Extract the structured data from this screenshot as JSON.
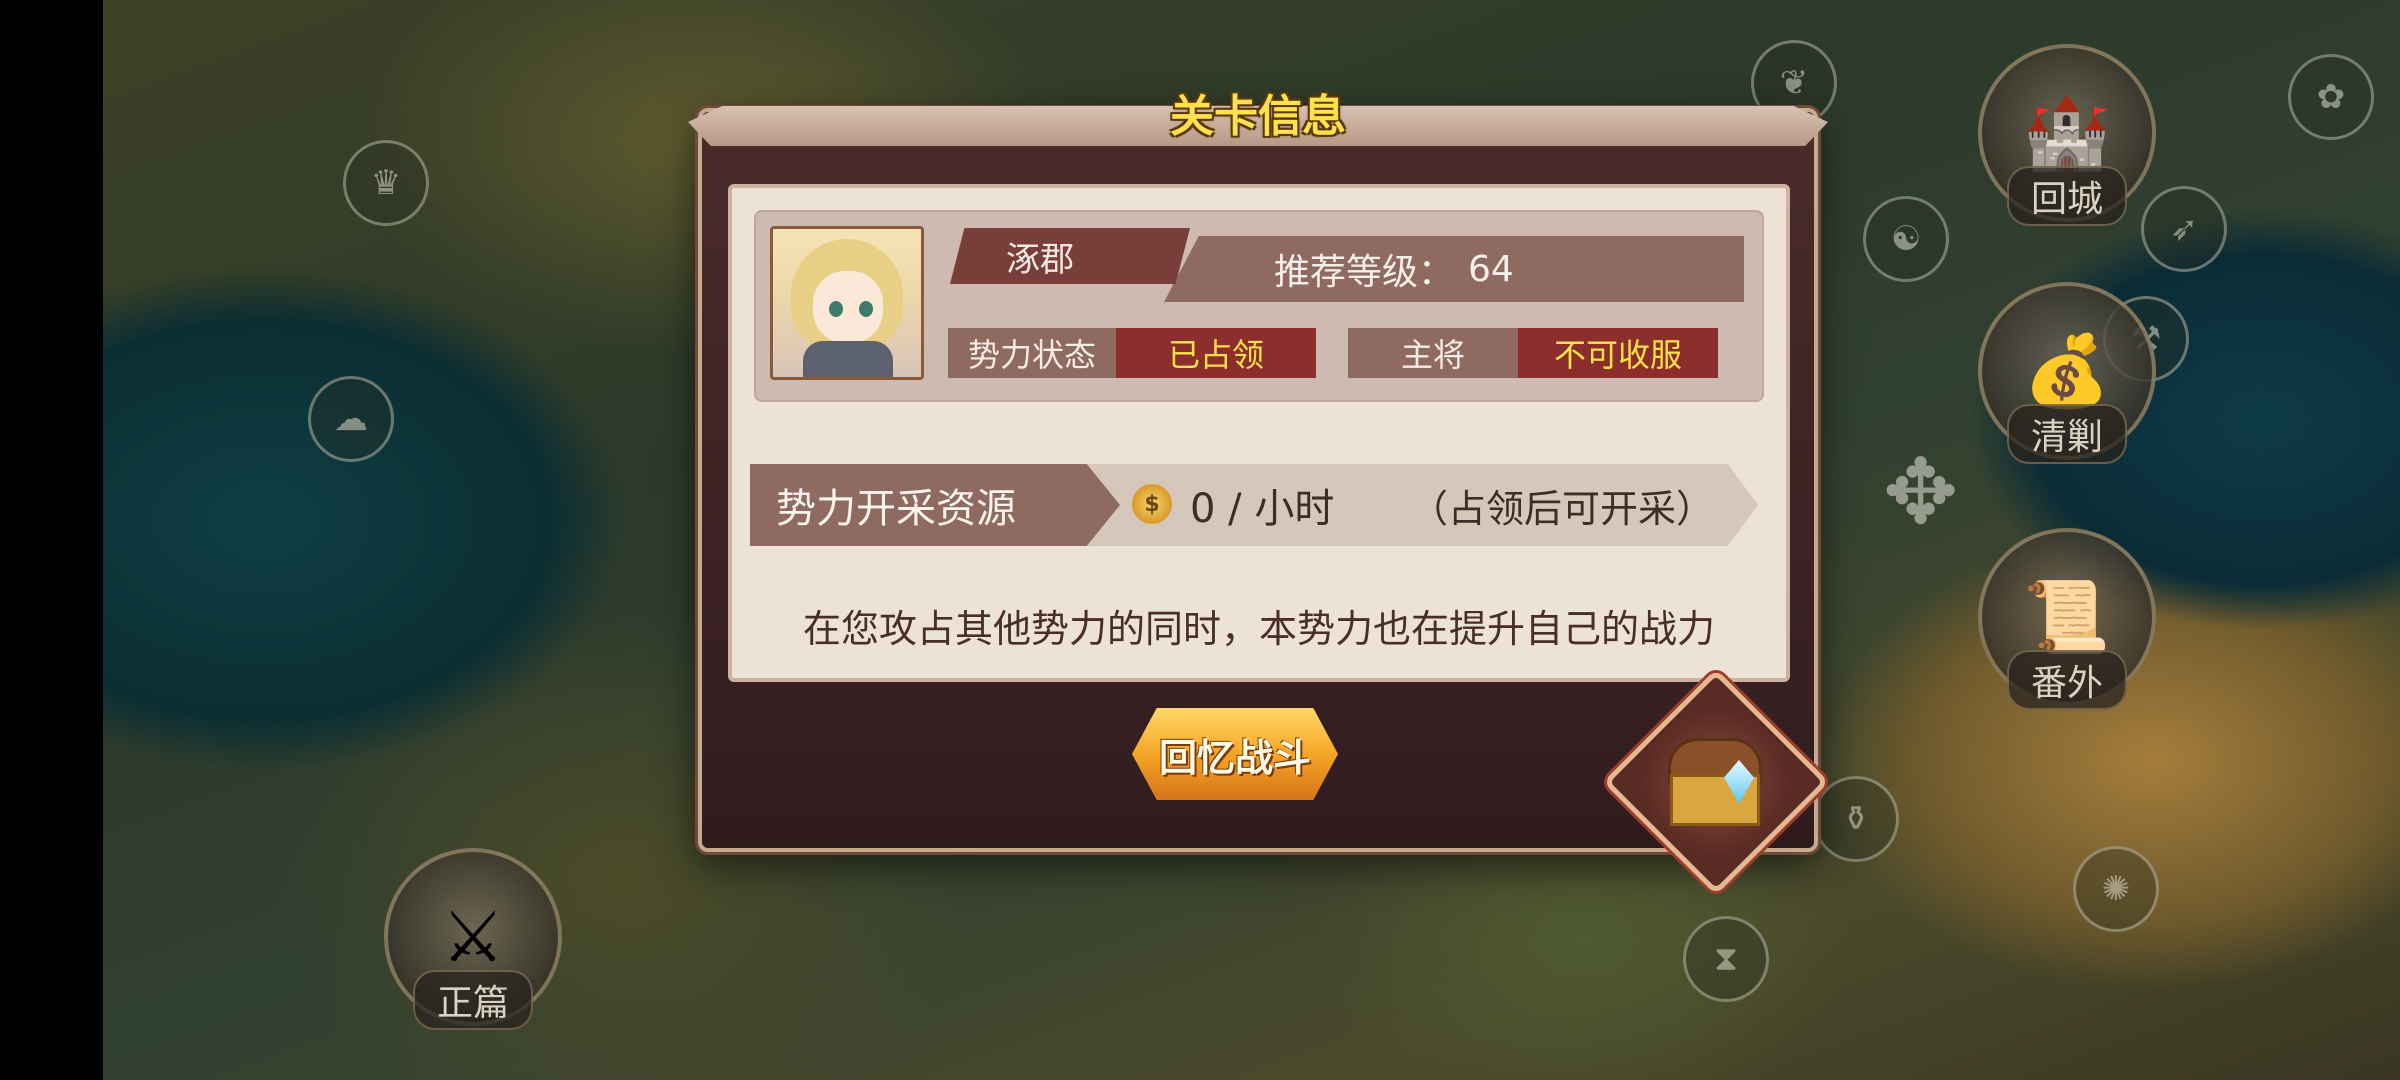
{
  "map": {
    "nodes": [
      {
        "icon": "crown-node-icon",
        "glyph": "♛"
      },
      {
        "icon": "cloud-node-icon",
        "glyph": "☁"
      },
      {
        "icon": "leaf-node-icon",
        "glyph": "❦"
      },
      {
        "icon": "flower-node-icon",
        "glyph": "✿"
      },
      {
        "icon": "swirl-node-icon",
        "glyph": "☯"
      },
      {
        "icon": "bow-node-icon",
        "glyph": "➶"
      },
      {
        "icon": "axe-node-icon",
        "glyph": "⚒"
      },
      {
        "icon": "gourd-node-icon",
        "glyph": "⚱"
      },
      {
        "icon": "hourglass-node-icon",
        "glyph": "⧗"
      },
      {
        "icon": "wheel-node-icon",
        "glyph": "✺"
      }
    ],
    "emblem_glyph": "✥"
  },
  "side_buttons": {
    "return_city": {
      "label": "回城",
      "icon": "castle-icon",
      "glyph": "🏰"
    },
    "sweep": {
      "label": "清剿",
      "icon": "treasure-pile-icon",
      "glyph": "💰"
    },
    "extra": {
      "label": "番外",
      "icon": "scroll-map-icon",
      "glyph": "📜"
    },
    "main_story": {
      "label": "正篇",
      "icon": "crossed-swords-icon",
      "glyph": "⚔"
    }
  },
  "dialog": {
    "title": "关卡信息",
    "stage": {
      "name": "涿郡",
      "recommended_level_label": "推荐等级：",
      "recommended_level": "64",
      "faction_status_label": "势力状态",
      "faction_status_value": "已占领",
      "general_label": "主将",
      "general_value": "不可收服"
    },
    "resource": {
      "label": "势力开采资源",
      "coin_glyph": "$",
      "rate": "0 / 小时",
      "note": "（占领后可开采）"
    },
    "description": "在您攻占其他势力的同时，本势力也在提升自己的战力",
    "recall_button": "回忆战斗",
    "colors": {
      "title": "#ffe14d",
      "status_value": "#ffe34a",
      "status_value_bg": "#8b2e2c",
      "frame": "#3b2224",
      "button": "#f5a625"
    }
  }
}
